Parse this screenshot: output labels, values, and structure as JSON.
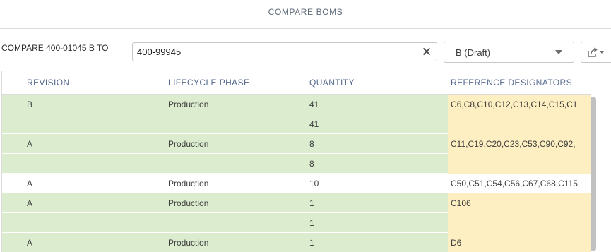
{
  "header": {
    "title": "COMPARE BOMS"
  },
  "compare": {
    "label": "COMPARE 400-01045 B TO",
    "input_value": "400-99945",
    "clear_icon": "close-icon"
  },
  "revision_select": {
    "selected": "B (Draft)",
    "icon": "chevron-down-icon"
  },
  "export": {
    "icon": "share-icon"
  },
  "colors": {
    "changed_row": "#dbeccf",
    "changed_ref": "#fdefc1",
    "header_text": "#54698d"
  },
  "table": {
    "columns": [
      "REVISION",
      "LIFECYCLE PHASE",
      "QUANTITY",
      "REFERENCE DESIGNATORS"
    ],
    "rows": [
      {
        "revision": "B",
        "phase": "Production",
        "quantity": "41",
        "refdes": "C6,C8,C10,C12,C13,C14,C15,C1",
        "highlight": "green",
        "ref_highlight": "yellow"
      },
      {
        "revision": "",
        "phase": "",
        "quantity": "41",
        "refdes": "",
        "highlight": "green",
        "ref_highlight": "yellow"
      },
      {
        "revision": "A",
        "phase": "Production",
        "quantity": "8",
        "refdes": "C11,C19,C20,C23,C53,C90,C92,",
        "highlight": "green",
        "ref_highlight": "yellow"
      },
      {
        "revision": "",
        "phase": "",
        "quantity": "8",
        "refdes": "",
        "highlight": "green",
        "ref_highlight": "yellow"
      },
      {
        "revision": "A",
        "phase": "Production",
        "quantity": "10",
        "refdes": "C50,C51,C54,C56,C67,C68,C115",
        "highlight": "none",
        "ref_highlight": "none"
      },
      {
        "revision": "A",
        "phase": "Production",
        "quantity": "1",
        "refdes": "C106",
        "highlight": "green",
        "ref_highlight": "yellow"
      },
      {
        "revision": "",
        "phase": "",
        "quantity": "1",
        "refdes": "",
        "highlight": "green",
        "ref_highlight": "yellow"
      },
      {
        "revision": "A",
        "phase": "Production",
        "quantity": "1",
        "refdes": "D6",
        "highlight": "green",
        "ref_highlight": "yellow"
      }
    ]
  }
}
